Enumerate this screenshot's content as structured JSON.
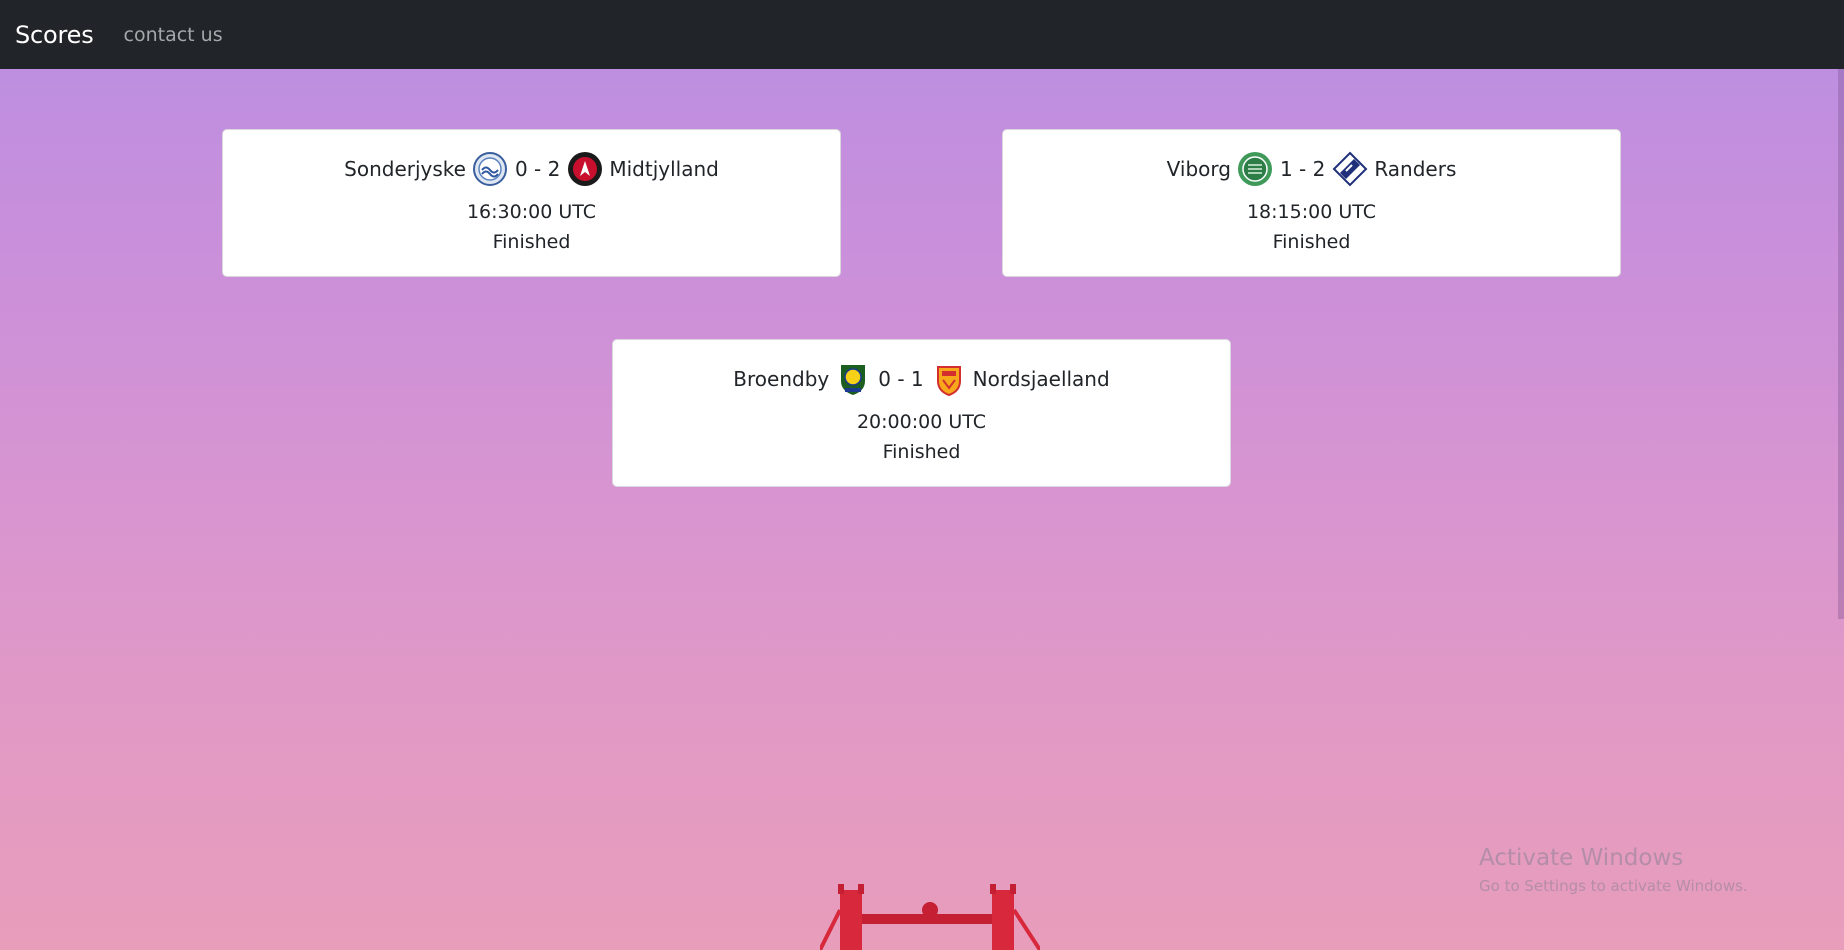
{
  "navbar": {
    "brand": "Scores",
    "contact": "contact us"
  },
  "matches": [
    {
      "home": "Sonderjyske",
      "away": "Midtjylland",
      "score": "0 - 2",
      "time": "16:30:00 UTC",
      "status": "Finished"
    },
    {
      "home": "Viborg",
      "away": "Randers",
      "score": "1 - 2",
      "time": "18:15:00 UTC",
      "status": "Finished"
    },
    {
      "home": "Broendby",
      "away": "Nordsjaelland",
      "score": "0 - 1",
      "time": "20:00:00 UTC",
      "status": "Finished"
    }
  ],
  "watermark": {
    "line1": "Activate Windows",
    "line2": "Go to Settings to activate Windows."
  },
  "colors": {
    "navbar": "#212529",
    "card": "#ffffff",
    "text": "#212529"
  },
  "icons": {
    "sonderjyske": "sonderjyske-crest-icon",
    "midtjylland": "midtjylland-crest-icon",
    "viborg": "viborg-crest-icon",
    "randers": "randers-crest-icon",
    "broendby": "broendby-crest-icon",
    "nordsjaelland": "nordsjaelland-crest-icon"
  }
}
